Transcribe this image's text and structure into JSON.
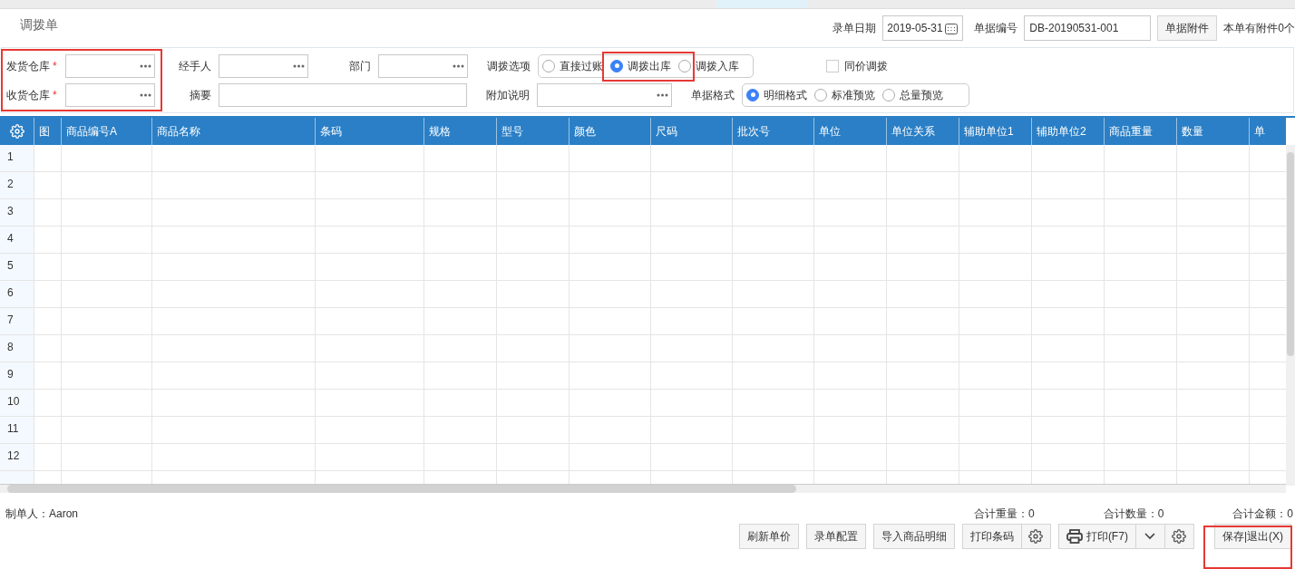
{
  "title": "调拨单",
  "header": {
    "date_label": "录单日期",
    "date_value": "2019-05-31",
    "number_label": "单据编号",
    "number_value": "DB-20190531-001",
    "attach_button": "单据附件",
    "attach_note": "本单有附件0个"
  },
  "form": {
    "ship_warehouse": {
      "label": "发货仓库",
      "required_mark": "*"
    },
    "receive_warehouse": {
      "label": "收货仓库",
      "required_mark": "*"
    },
    "handler": {
      "label": "经手人"
    },
    "department": {
      "label": "部门"
    },
    "summary": {
      "label": "摘要"
    },
    "extra_note": {
      "label": "附加说明"
    },
    "transfer_options": {
      "label": "调拨选项",
      "options": [
        {
          "label": "直接过账",
          "selected": false
        },
        {
          "label": "调拨出库",
          "selected": true
        },
        {
          "label": "调拨入库",
          "selected": false
        }
      ]
    },
    "same_price": {
      "label": "同价调拨",
      "checked": false
    },
    "format": {
      "label": "单据格式",
      "options": [
        {
          "label": "明细格式",
          "selected": true
        },
        {
          "label": "标准预览",
          "selected": false
        },
        {
          "label": "总量预览",
          "selected": false
        }
      ]
    }
  },
  "table": {
    "columns": [
      {
        "label": "图"
      },
      {
        "label": "商品编号A"
      },
      {
        "label": "商品名称"
      },
      {
        "label": "条码"
      },
      {
        "label": "规格"
      },
      {
        "label": "型号"
      },
      {
        "label": "颜色"
      },
      {
        "label": "尺码"
      },
      {
        "label": "批次号"
      },
      {
        "label": "单位"
      },
      {
        "label": "单位关系"
      },
      {
        "label": "辅助单位1"
      },
      {
        "label": "辅助单位2"
      },
      {
        "label": "商品重量"
      },
      {
        "label": "数量"
      },
      {
        "label": "单"
      }
    ],
    "row_numbers": [
      "1",
      "2",
      "3",
      "4",
      "5",
      "6",
      "7",
      "8",
      "9",
      "10",
      "11",
      "12"
    ]
  },
  "footer": {
    "maker": "制单人：Aaron",
    "totals": [
      "合计重量：0",
      "合计数量：0",
      "合计金额：0"
    ]
  },
  "buttons": {
    "refresh": "刷新单价",
    "config": "录单配置",
    "import": "导入商品明细",
    "print_barcode": "打印条码",
    "print": "打印(F7)",
    "save_exit": "保存|退出(X)"
  }
}
